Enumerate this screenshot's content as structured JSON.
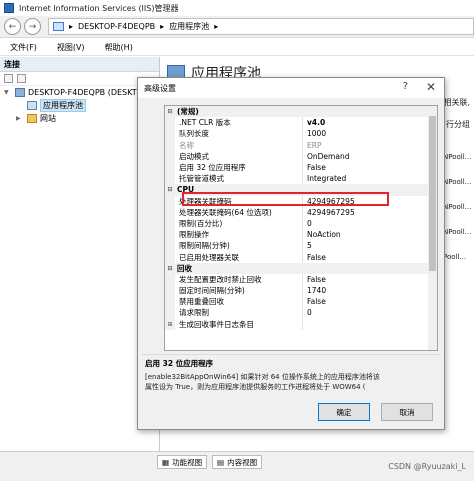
{
  "window": {
    "title": "Internet Information Services (IIS)管理器"
  },
  "address": {
    "path": [
      "DESKTOP-F4DEQPB",
      "应用程序池"
    ],
    "back_glyph": "←",
    "forward_glyph": "→"
  },
  "menu": [
    "文件(F)",
    "视图(V)",
    "帮助(H)"
  ],
  "connections": {
    "header": "连接",
    "tree": [
      {
        "label": "DESKTOP-F4DEQPB (DESKTOP-",
        "level": 0,
        "icon": "server-icon",
        "expander": "▼"
      },
      {
        "label": "应用程序池",
        "level": 1,
        "icon": "app-pool-icon",
        "selected": true,
        "expander": ""
      },
      {
        "label": "网站",
        "level": 1,
        "icon": "sites-folder-icon",
        "expander": "▶"
      }
    ]
  },
  "background": {
    "page_title": "应用程序池",
    "side_text": [
      "相关联,",
      "行分组"
    ],
    "list_items": [
      "NPooll...",
      "NPooll...",
      "NPooll...",
      "NPooll...",
      "Pooll..."
    ]
  },
  "dialog": {
    "title": "高级设置",
    "help": "?",
    "close": "✕",
    "rows": [
      {
        "type": "cat",
        "exp": "⊟",
        "name": "(常规)",
        "value": ""
      },
      {
        "type": "prop",
        "name": ".NET CLR 版本",
        "value": "v4.0",
        "bold": true
      },
      {
        "type": "prop",
        "name": "队列长度",
        "value": "1000"
      },
      {
        "type": "prop",
        "name": "名称",
        "value": "ERP",
        "dim": true
      },
      {
        "type": "prop",
        "name": "启动模式",
        "value": "OnDemand"
      },
      {
        "type": "prop",
        "name": "启用 32 位应用程序",
        "value": "False"
      },
      {
        "type": "prop",
        "name": "托管管道模式",
        "value": "Integrated"
      },
      {
        "type": "cat",
        "exp": "⊟",
        "name": "CPU",
        "value": ""
      },
      {
        "type": "prop",
        "name": "处理器关联掩码",
        "value": "4294967295"
      },
      {
        "type": "prop",
        "name": "处理器关联掩码(64 位选项)",
        "value": "4294967295"
      },
      {
        "type": "prop",
        "name": "限制(百分比)",
        "value": "0"
      },
      {
        "type": "prop",
        "name": "限制操作",
        "value": "NoAction"
      },
      {
        "type": "prop",
        "name": "限制间隔(分钟)",
        "value": "5"
      },
      {
        "type": "prop",
        "name": "已启用处理器关联",
        "value": "False"
      },
      {
        "type": "cat",
        "exp": "⊟",
        "name": "回收",
        "value": ""
      },
      {
        "type": "prop",
        "name": "发生配置更改时禁止回收",
        "value": "False"
      },
      {
        "type": "prop",
        "name": "固定时间间隔(分钟)",
        "value": "1740"
      },
      {
        "type": "prop",
        "name": "禁用重叠回收",
        "value": "False"
      },
      {
        "type": "prop",
        "name": "请求限制",
        "value": "0"
      },
      {
        "type": "prop",
        "exp": "⊞",
        "name": "生成回收事件日志条目",
        "value": ""
      }
    ],
    "description": {
      "title": "启用 32 位应用程序",
      "text": "[enable32BitAppOnWin64] 如果针对 64 位操作系统上的应用程序池将该属性设为 True，则为应用程序池提供服务的工作进程将处于 WOW64 (",
      "text_line1": "[enable32BitAppOnWin64] 如果针对 64 位操作系统上的应用程序池将该",
      "text_line2": "属性设为 True，则为应用程序池提供服务的工作进程将处于 WOW64 ("
    },
    "ok_label": "确定",
    "cancel_label": "取消"
  },
  "statusbar": {
    "features_view": "功能视图",
    "content_view": "内容视图",
    "watermark": "CSDN @Ryuuzaki_L"
  }
}
